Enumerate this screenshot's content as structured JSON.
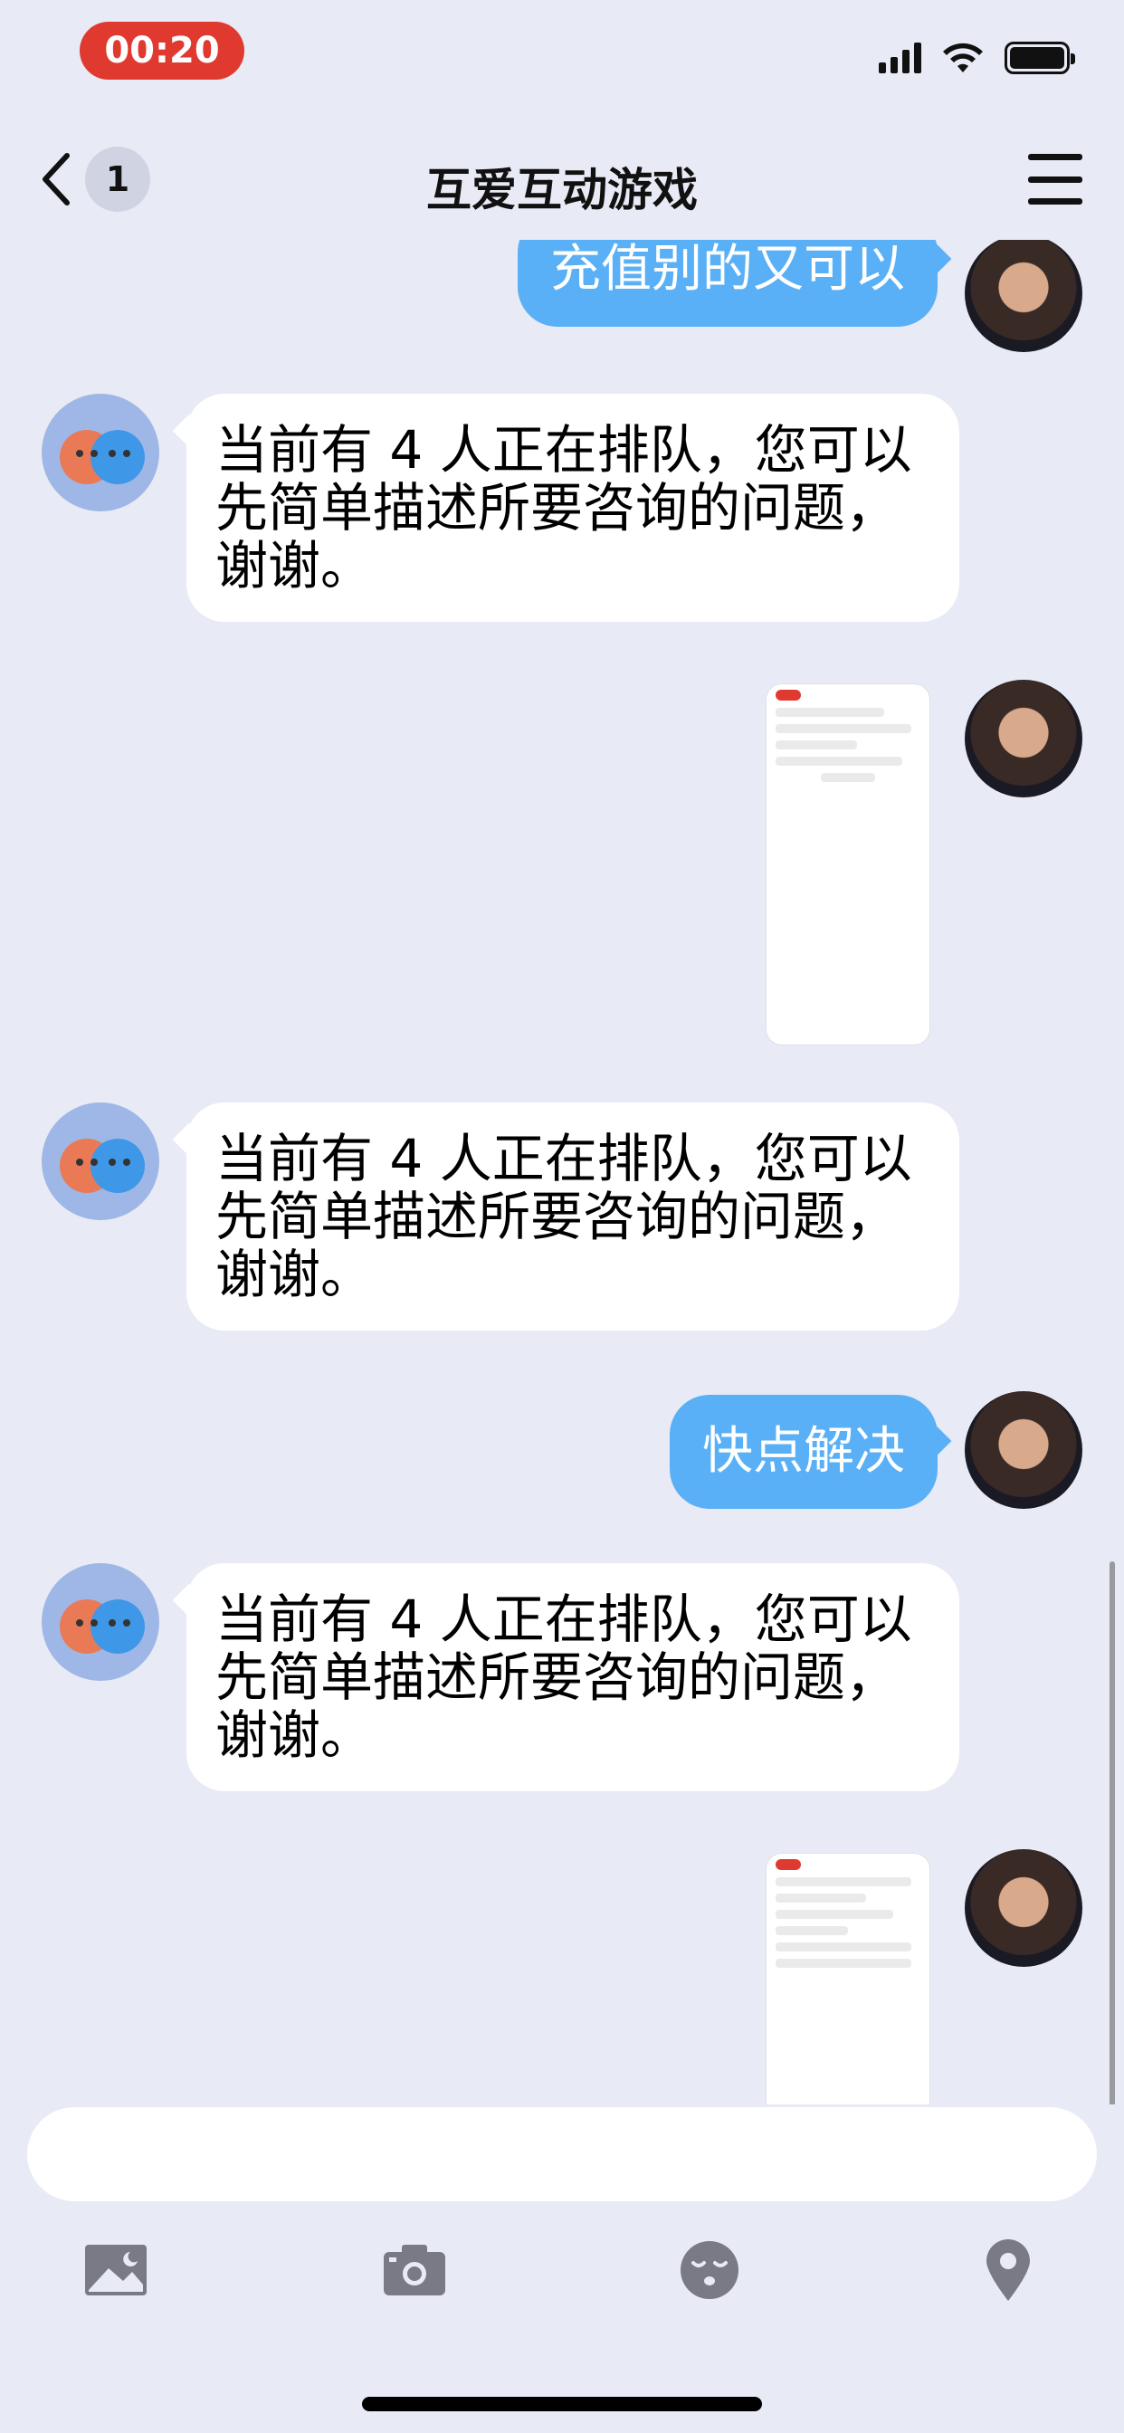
{
  "status_bar": {
    "time": "00:20"
  },
  "nav": {
    "back_count": "1",
    "title": "互爱互动游戏"
  },
  "messages": [
    {
      "from": "user",
      "text": "充值别的又可以"
    },
    {
      "from": "bot",
      "text": "当前有 4 人正在排队，您可以先简单描述所要咨询的问题，谢谢。"
    },
    {
      "from": "user",
      "type": "image",
      "content": "screenshot-thumbnail"
    },
    {
      "from": "bot",
      "text": "当前有 4 人正在排队，您可以先简单描述所要咨询的问题，谢谢。"
    },
    {
      "from": "user",
      "text": "快点解决"
    },
    {
      "from": "bot",
      "text": "当前有 4 人正在排队，您可以先简单描述所要咨询的问题，谢谢。"
    },
    {
      "from": "user",
      "type": "image",
      "content": "screenshot-thumbnail"
    }
  ],
  "input": {
    "placeholder": ""
  },
  "toolbar": {
    "icons": [
      "image-icon",
      "camera-icon",
      "emoji-icon",
      "location-icon"
    ]
  },
  "colors": {
    "user_bubble": "#5ab0f6",
    "bot_bubble": "#ffffff",
    "background": "#e8eaf5",
    "time_pill": "#e03a30"
  }
}
